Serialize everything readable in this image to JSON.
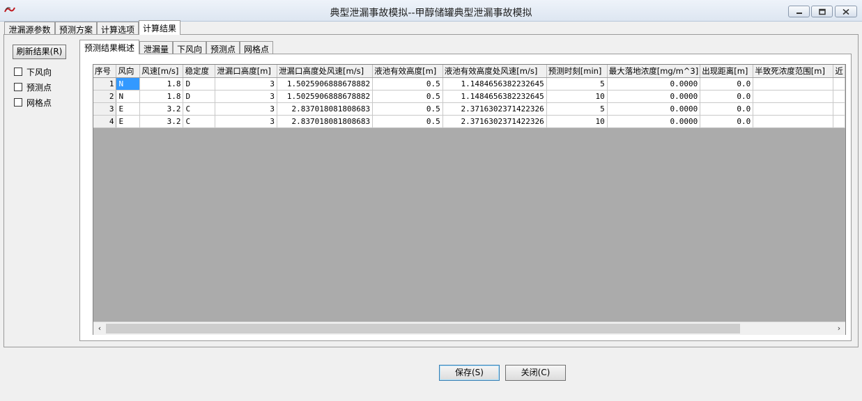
{
  "window": {
    "title": "典型泄漏事故模拟--甲醇储罐典型泄漏事故模拟"
  },
  "main_tabs": [
    "泄漏源参数",
    "预测方案",
    "计算选项",
    "计算结果"
  ],
  "left": {
    "refresh_label": "刷新结果(R)",
    "checkboxes": [
      "下风向",
      "预测点",
      "网格点"
    ]
  },
  "sub_tabs": [
    "预测结果概述",
    "泄漏量",
    "下风向",
    "预测点",
    "网格点"
  ],
  "table": {
    "headers": [
      "序号",
      "风向",
      "风速[m/s]",
      "稳定度",
      "泄漏口高度[m]",
      "泄漏口高度处风速[m/s]",
      "液池有效高度[m]",
      "液池有效高度处风速[m/s]",
      "预测时刻[min]",
      "最大落地浓度[mg/m^3]",
      "出现距离[m]",
      "半致死浓度范围[m]",
      "近"
    ],
    "rows": [
      [
        "1",
        "N",
        "1.8",
        "D",
        "3",
        "1.5025906888678882",
        "0.5",
        "1.1484656382232645",
        "5",
        "0.0000",
        "0.0",
        "",
        ""
      ],
      [
        "2",
        "N",
        "1.8",
        "D",
        "3",
        "1.5025906888678882",
        "0.5",
        "1.1484656382232645",
        "10",
        "0.0000",
        "0.0",
        "",
        ""
      ],
      [
        "3",
        "E",
        "3.2",
        "C",
        "3",
        "2.837018081808683",
        "0.5",
        "2.3716302371422326",
        "5",
        "0.0000",
        "0.0",
        "",
        ""
      ],
      [
        "4",
        "E",
        "3.2",
        "C",
        "3",
        "2.837018081808683",
        "0.5",
        "2.3716302371422326",
        "10",
        "0.0000",
        "0.0",
        "",
        ""
      ]
    ]
  },
  "buttons": {
    "save": "保存(S)",
    "close": "关闭(C)"
  },
  "icons": {
    "app": "app-logo-icon",
    "minimize": "minimize-icon",
    "maximize": "maximize-icon",
    "close": "close-icon",
    "scroll_left": "arrow-left-icon",
    "scroll_right": "arrow-right-icon"
  },
  "colors": {
    "selection": "#3399ff",
    "grid_empty": "#ababab"
  }
}
